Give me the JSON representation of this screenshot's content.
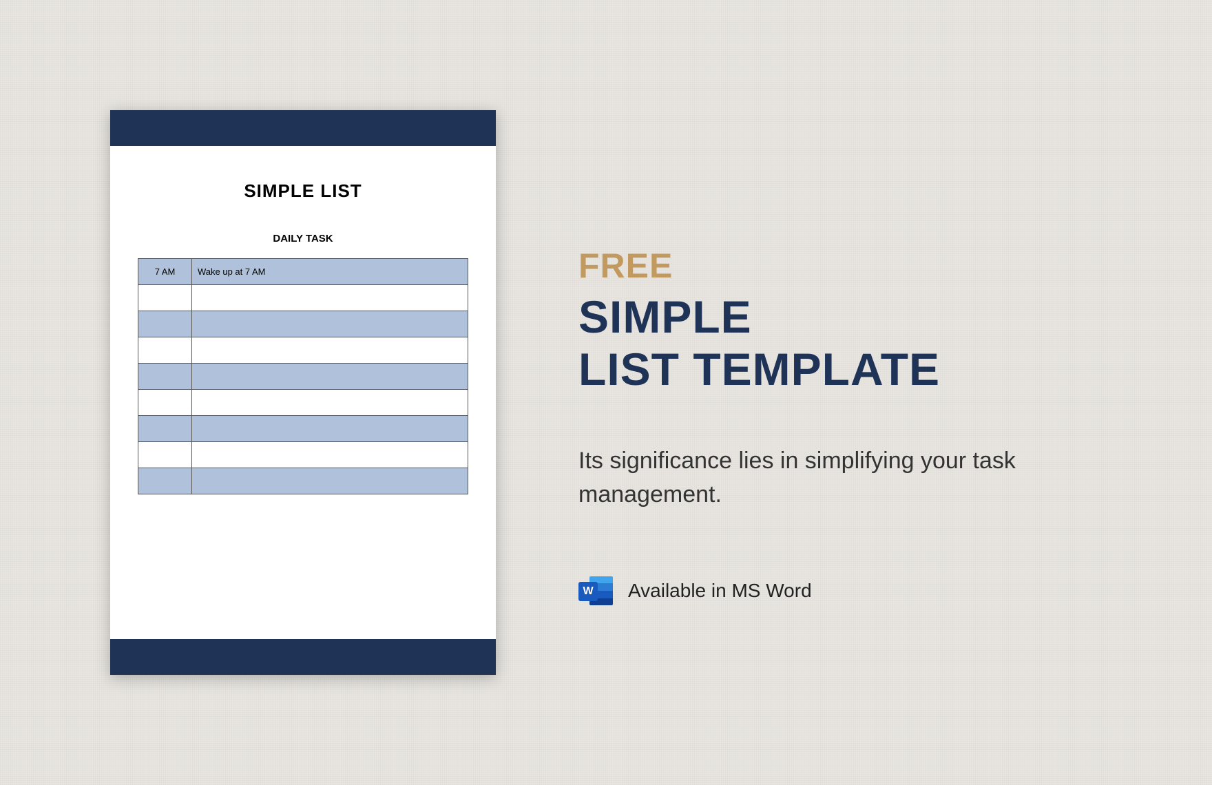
{
  "preview": {
    "title": "SIMPLE LIST",
    "subtitle": "DAILY TASK",
    "rows": [
      {
        "time": "7 AM",
        "task": "Wake up  at 7 AM"
      },
      {
        "time": "",
        "task": ""
      },
      {
        "time": "",
        "task": ""
      },
      {
        "time": "",
        "task": ""
      },
      {
        "time": "",
        "task": ""
      },
      {
        "time": "",
        "task": ""
      },
      {
        "time": "",
        "task": ""
      },
      {
        "time": "",
        "task": ""
      },
      {
        "time": "",
        "task": ""
      }
    ]
  },
  "info": {
    "badge": "FREE",
    "title_line1": "SIMPLE",
    "title_line2": "LIST TEMPLATE",
    "description": "Its significance lies in simplifying your task management.",
    "availability": "Available in MS Word",
    "word_letter": "W"
  },
  "colors": {
    "band": "#1e3356",
    "row_blue": "#b0c2db",
    "badge": "#c29a5f"
  }
}
